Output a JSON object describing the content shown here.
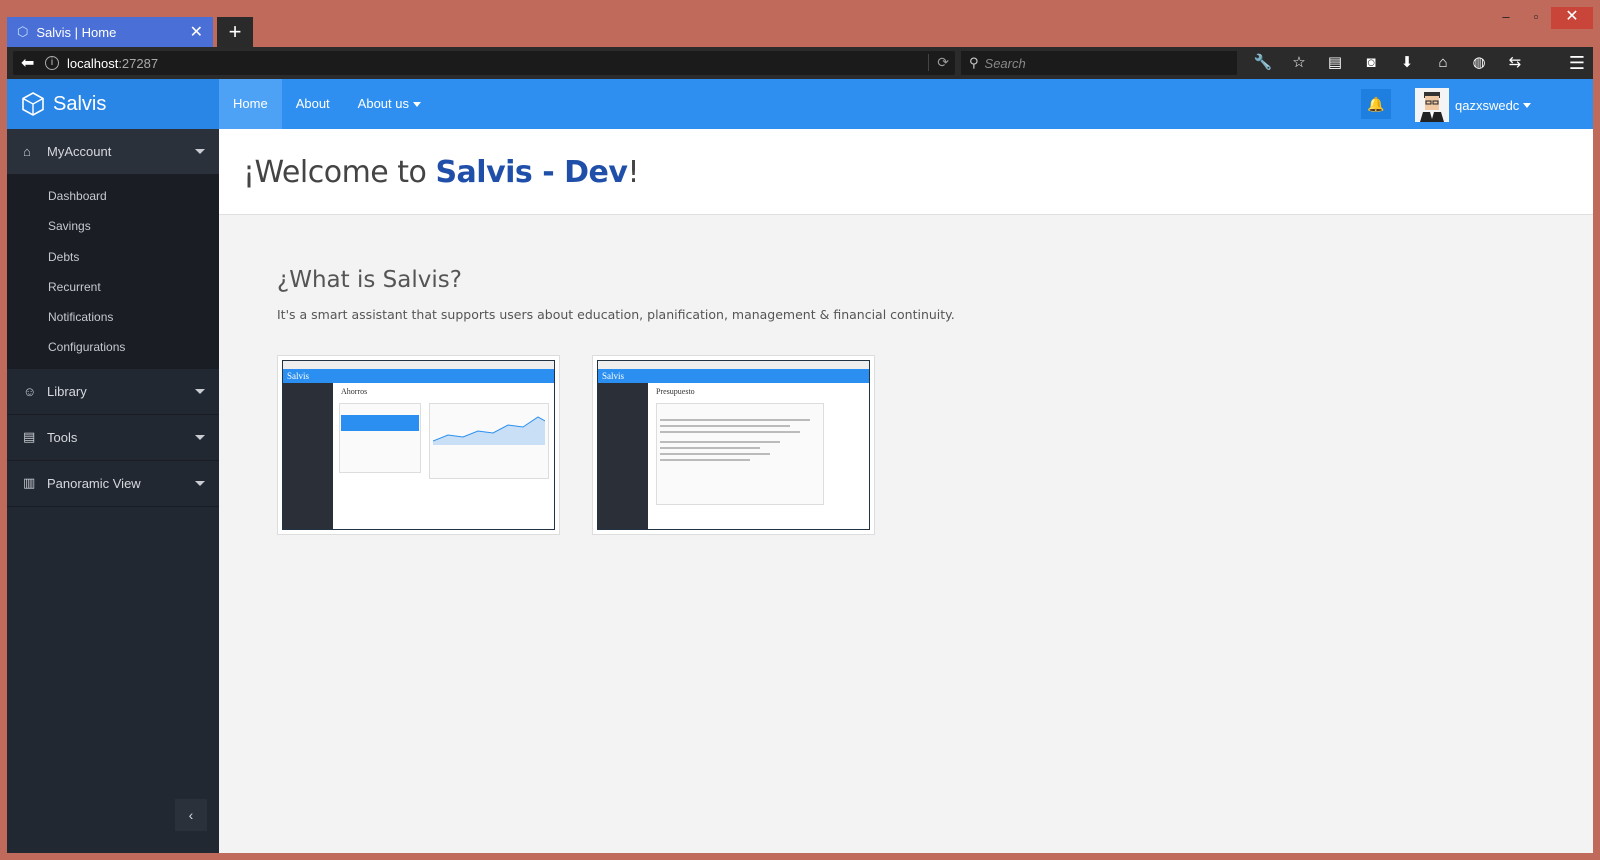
{
  "browser": {
    "tab_title": "Salvis | Home",
    "new_tab": "+",
    "url_host": "localhost",
    "url_port": ":27287",
    "search_placeholder": "Search"
  },
  "header": {
    "brand": "Salvis",
    "nav": [
      {
        "label": "Home",
        "active": true
      },
      {
        "label": "About",
        "active": false
      },
      {
        "label": "About us",
        "active": false,
        "dropdown": true
      }
    ],
    "username": "qazxswedc"
  },
  "sidebar": {
    "sections": [
      {
        "label": "MyAccount",
        "icon": "home-icon",
        "open": true,
        "items": [
          "Dashboard",
          "Savings",
          "Debts",
          "Recurrent",
          "Notifications",
          "Configurations"
        ]
      },
      {
        "label": "Library",
        "icon": "smile-icon",
        "open": false
      },
      {
        "label": "Tools",
        "icon": "list-icon",
        "open": false
      },
      {
        "label": "Panoramic View",
        "icon": "bar-chart-icon",
        "open": false
      }
    ]
  },
  "main": {
    "welcome_prefix": "¡Welcome to ",
    "welcome_brand": "Salvis - Dev",
    "welcome_suffix": "!",
    "question": "¿What is Salvis?",
    "description": "It's a smart assistant that supports users about education, planification, management & financial continuity.",
    "screenshots": [
      {
        "brand": "Salvis",
        "title": "Ahorros"
      },
      {
        "brand": "Salvis",
        "title": "Presupuesto"
      }
    ]
  },
  "colors": {
    "accent": "#2e8ff0",
    "sidebar": "#222831",
    "brand_text": "#1f4fa8"
  }
}
